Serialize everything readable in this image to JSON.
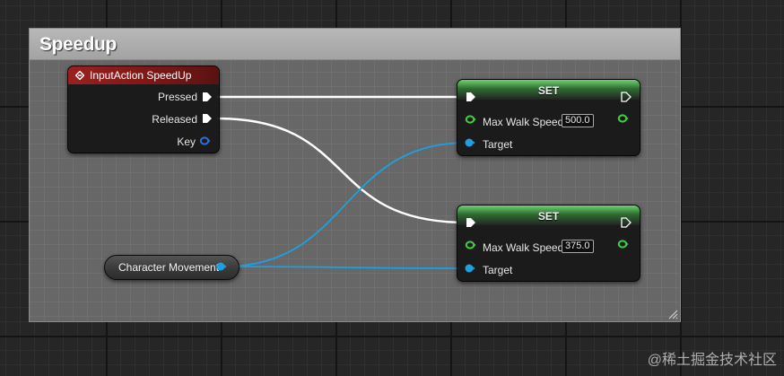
{
  "comment": {
    "title": "Speedup"
  },
  "event_node": {
    "title": "InputAction SpeedUp",
    "pins": {
      "pressed": "Pressed",
      "released": "Released",
      "key": "Key"
    }
  },
  "set_nodes": [
    {
      "title": "SET",
      "property_label": "Max Walk Speed",
      "value": "500.0",
      "target_label": "Target"
    },
    {
      "title": "SET",
      "property_label": "Max Walk Speed",
      "value": "375.0",
      "target_label": "Target"
    }
  ],
  "variable_node": {
    "label": "Character Movement"
  },
  "watermark": "@稀土掘金技术社区",
  "colors": {
    "event_header": "#9b2020",
    "set_header": "#6fd16f",
    "exec_wire": "#ffffff",
    "object_wire": "#1e9fe0",
    "float_pin": "#3dd13d",
    "key_pin": "#2a6fdc",
    "comment_header": "#b0b0b0"
  },
  "icons": {
    "event": "event-diamond-icon",
    "exec_pin": "exec-arrow-icon",
    "object_pin": "object-dot-icon",
    "float_pin": "float-ring-icon",
    "struct_pin": "struct-ring-icon",
    "resize": "resize-grip-icon"
  }
}
